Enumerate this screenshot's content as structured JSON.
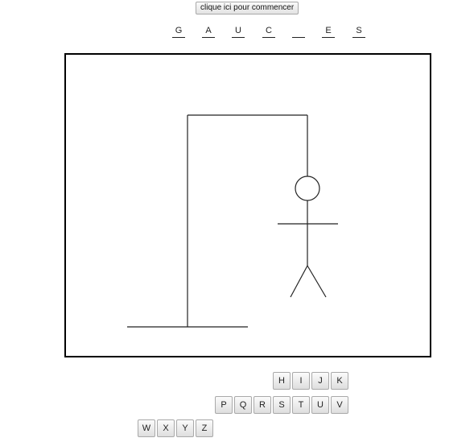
{
  "start_button": "clique ici pour commencer",
  "word": [
    "G",
    "A",
    "U",
    "C",
    "",
    "E",
    "S"
  ],
  "keyboard": {
    "row1": [
      "H",
      "I",
      "J",
      "K"
    ],
    "row2": [
      "P",
      "Q",
      "R",
      "S",
      "T",
      "U",
      "V"
    ],
    "row3": [
      "W",
      "X",
      "Y",
      "Z"
    ]
  },
  "hangman": {
    "stage": "complete",
    "parts_drawn": [
      "ground",
      "pole",
      "beam",
      "rope",
      "head",
      "body",
      "arms",
      "legs"
    ]
  }
}
